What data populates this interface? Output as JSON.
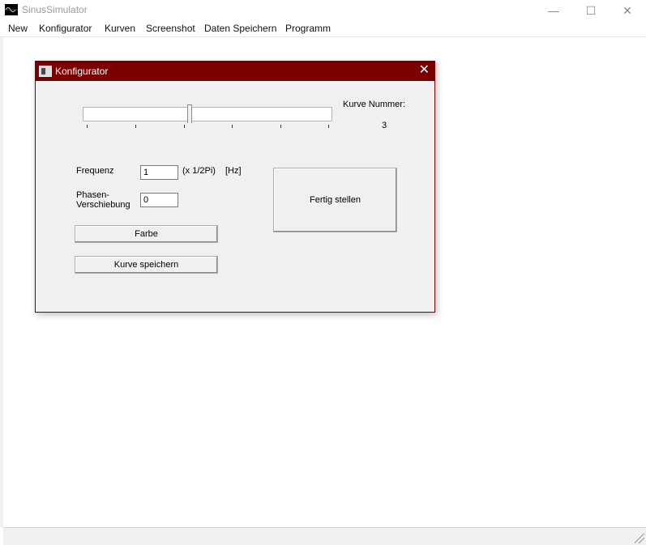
{
  "window": {
    "title": "SinusSimulator",
    "minimize": "—",
    "maximize": "☐",
    "close": "✕"
  },
  "menu": [
    "New",
    "Konfigurator",
    "Kurven",
    "Screenshot",
    "Daten Speichern",
    "Programm"
  ],
  "dialog": {
    "title": "Konfigurator",
    "close": "✕",
    "kurve_label": "Kurve Nummer:",
    "kurve_value": "3",
    "slider_level": 0.43,
    "frequenz_label": "Frequenz",
    "frequenz_value": "1",
    "frequenz_unit1": "(x 1/2Pi)",
    "frequenz_unit2": "[Hz]",
    "phase_label_1": "Phasen-",
    "phase_label_2": "Verschiebung",
    "phase_value": "0",
    "farbe_button": "Farbe",
    "speichern_button": "Kurve speichern",
    "fertig_button": "Fertig stellen"
  }
}
